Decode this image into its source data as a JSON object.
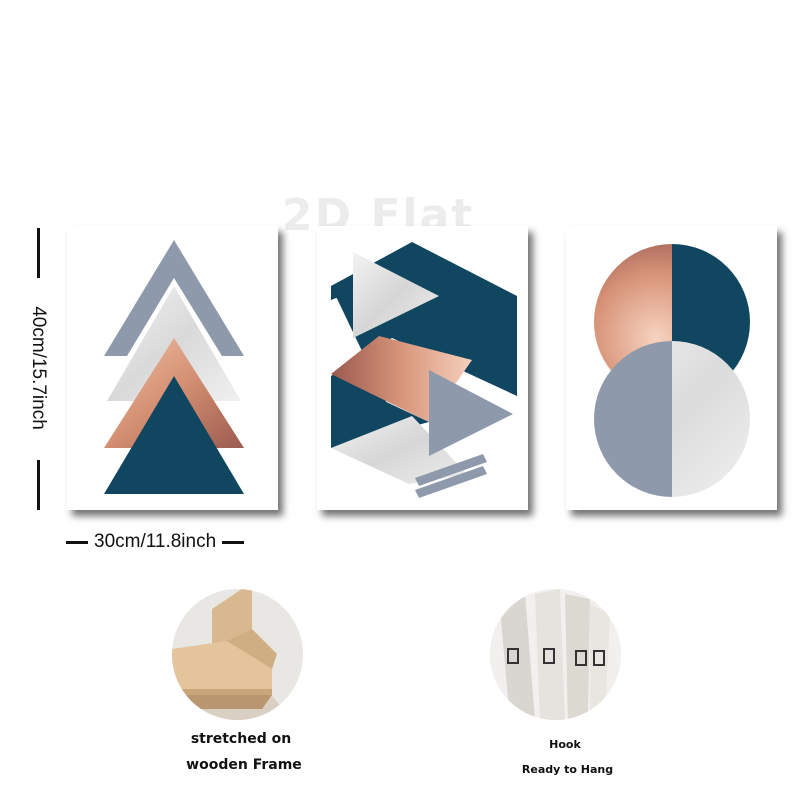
{
  "watermark": "2D Flat",
  "dimensions": {
    "height_label": "40cm/15.7inch",
    "width_label": "30cm/11.8inch"
  },
  "panels": [
    {
      "name": "stacked-triangles-print"
    },
    {
      "name": "geometric-hexagon-print"
    },
    {
      "name": "split-circles-print"
    }
  ],
  "colors": {
    "navy": "#114661",
    "slate_gray": "#8e9aab",
    "rose_gold": "#d89a7c",
    "marble": "#e4e4e4"
  },
  "features": {
    "frame": {
      "caption_line1": "stretched on",
      "caption_line2": "wooden Frame"
    },
    "hook": {
      "caption_line1": "Hook",
      "caption_line2": "Ready to Hang"
    }
  }
}
